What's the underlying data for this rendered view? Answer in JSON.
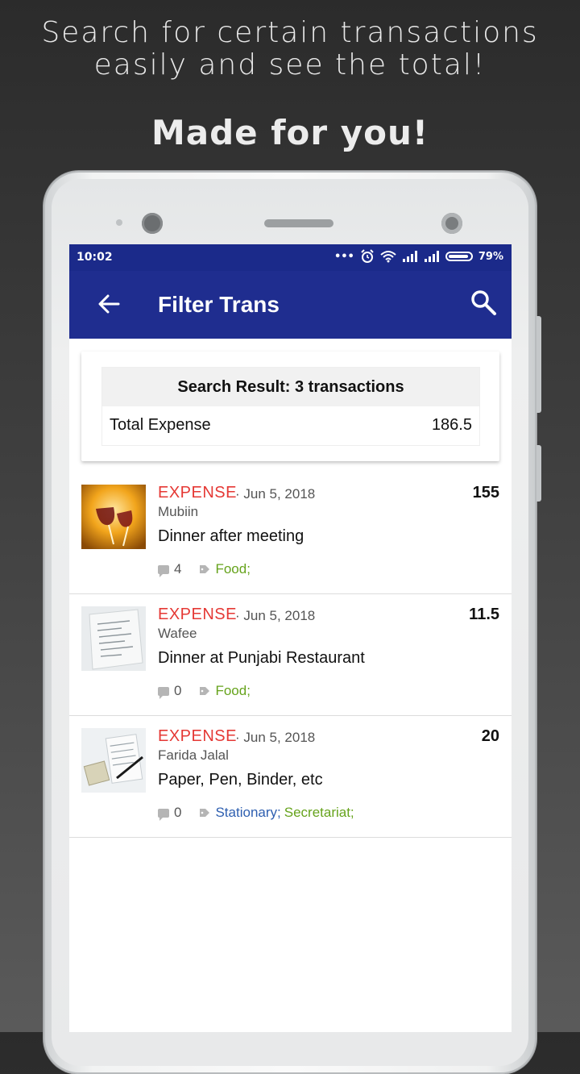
{
  "promo": {
    "line1": "Search for certain transactions",
    "line2": "easily and see the total!",
    "headline": "Made for you!"
  },
  "status_bar": {
    "time": "10:02",
    "battery": "79%"
  },
  "appbar": {
    "title": "Filter Trans"
  },
  "summary": {
    "header": "Search Result: 3 transactions",
    "total_label": "Total Expense",
    "total_value": "186.5"
  },
  "transactions": [
    {
      "type": "EXPENSE",
      "date": "· Jun 5, 2018",
      "payee": "Mubiin",
      "description": "Dinner after meeting",
      "amount": "155",
      "comments": "4",
      "categories": [
        {
          "label": "Food;",
          "color": "#66a31c"
        }
      ]
    },
    {
      "type": "EXPENSE",
      "date": "· Jun 5, 2018",
      "payee": "Wafee",
      "description": "Dinner at Punjabi Restaurant",
      "amount": "11.5",
      "comments": "0",
      "categories": [
        {
          "label": "Food;",
          "color": "#66a31c"
        }
      ]
    },
    {
      "type": "EXPENSE",
      "date": "· Jun 5, 2018",
      "payee": "Farida Jalal",
      "description": "Paper, Pen, Binder, etc",
      "amount": "20",
      "comments": "0",
      "categories": [
        {
          "label": "Stationary;",
          "color": "#2e5fb0"
        },
        {
          "label": "Secretariat;",
          "color": "#66a31c"
        }
      ]
    }
  ],
  "colors": {
    "appbar": "#1f2d8f",
    "expense": "#e53935"
  }
}
